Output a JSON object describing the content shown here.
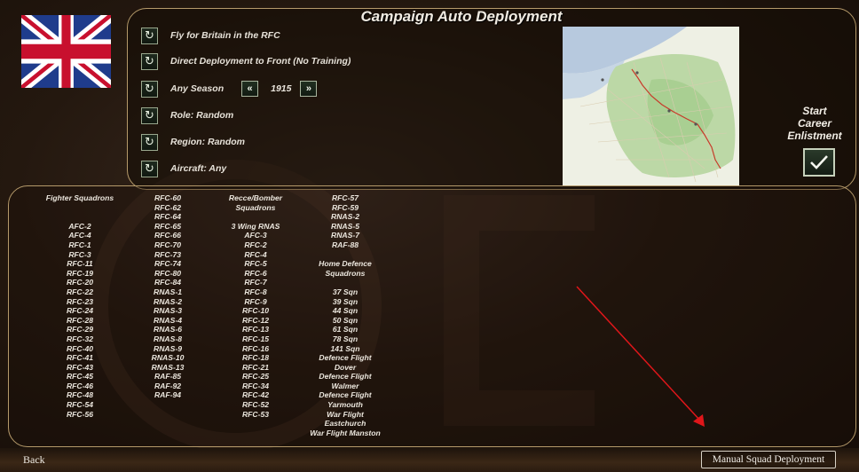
{
  "header": {
    "title": "Campaign Auto Deployment"
  },
  "nationality": {
    "flag_icon": "union-jack-flag"
  },
  "options": [
    {
      "label": "Fly for Britain in the RFC",
      "icon": "cycle-icon"
    },
    {
      "label": "Direct Deployment to Front (No Training)",
      "icon": "cycle-icon"
    },
    {
      "label": "Any Season",
      "icon": "cycle-icon",
      "year": "1915",
      "prev_icon": "double-left-arrow",
      "next_icon": "double-right-arrow"
    },
    {
      "label": "Role: Random",
      "icon": "cycle-icon"
    },
    {
      "label": "Region: Random",
      "icon": "cycle-icon"
    },
    {
      "label": "Aircraft: Any",
      "icon": "cycle-icon"
    }
  ],
  "career": {
    "line1": "Start",
    "line2": "Career",
    "line3": "Enlistment",
    "confirm_icon": "checkmark-icon"
  },
  "squadrons": {
    "col1": [
      "Fighter Squadrons",
      "",
      "",
      "AFC-2",
      "AFC-4",
      "RFC-1",
      "RFC-3",
      "RFC-11",
      "RFC-19",
      "RFC-20",
      "RFC-22",
      "RFC-23",
      "RFC-24",
      "RFC-28",
      "RFC-29",
      "RFC-32",
      "RFC-40",
      "RFC-41",
      "RFC-43",
      "RFC-45",
      "RFC-46",
      "RFC-48",
      "RFC-54",
      "RFC-56"
    ],
    "col2": [
      "RFC-60",
      "RFC-62",
      "RFC-64",
      "RFC-65",
      "RFC-66",
      "RFC-70",
      "RFC-73",
      "RFC-74",
      "RFC-80",
      "RFC-84",
      "RNAS-1",
      "RNAS-2",
      "RNAS-3",
      "RNAS-4",
      "RNAS-6",
      "RNAS-8",
      "RNAS-9",
      "RNAS-10",
      "RNAS-13",
      "RAF-85",
      "RAF-92",
      "RAF-94"
    ],
    "col3": [
      "Recce/Bomber",
      "Squadrons",
      "",
      "3 Wing RNAS",
      "AFC-3",
      "RFC-2",
      "RFC-4",
      "RFC-5",
      "RFC-6",
      "RFC-7",
      "RFC-8",
      "RFC-9",
      "RFC-10",
      "RFC-12",
      "RFC-13",
      "RFC-15",
      "RFC-16",
      "RFC-18",
      "RFC-21",
      "RFC-25",
      "RFC-34",
      "RFC-42",
      "RFC-52",
      "RFC-53"
    ],
    "col4": [
      "RFC-57",
      "RFC-59",
      "RNAS-2",
      "RNAS-5",
      "RNAS-7",
      "RAF-88",
      "",
      "Home Defence",
      "Squadrons",
      "",
      "37 Sqn",
      "39 Sqn",
      "44 Sqn",
      "50 Sqn",
      "61 Sqn",
      "78 Sqn",
      "141 Sqn",
      "Defence Flight",
      "Dover",
      "Defence Flight",
      "Walmer",
      "Defence Flight",
      "Yarmouth",
      "War Flight",
      "Eastchurch",
      "War Flight Manston"
    ]
  },
  "footer": {
    "back_label": "Back",
    "manual_label": "Manual Squad Deployment"
  },
  "colors": {
    "annotation_arrow": "#e0161a",
    "panel_border": "#b59a6a",
    "button_green": "#1e2a1e"
  }
}
